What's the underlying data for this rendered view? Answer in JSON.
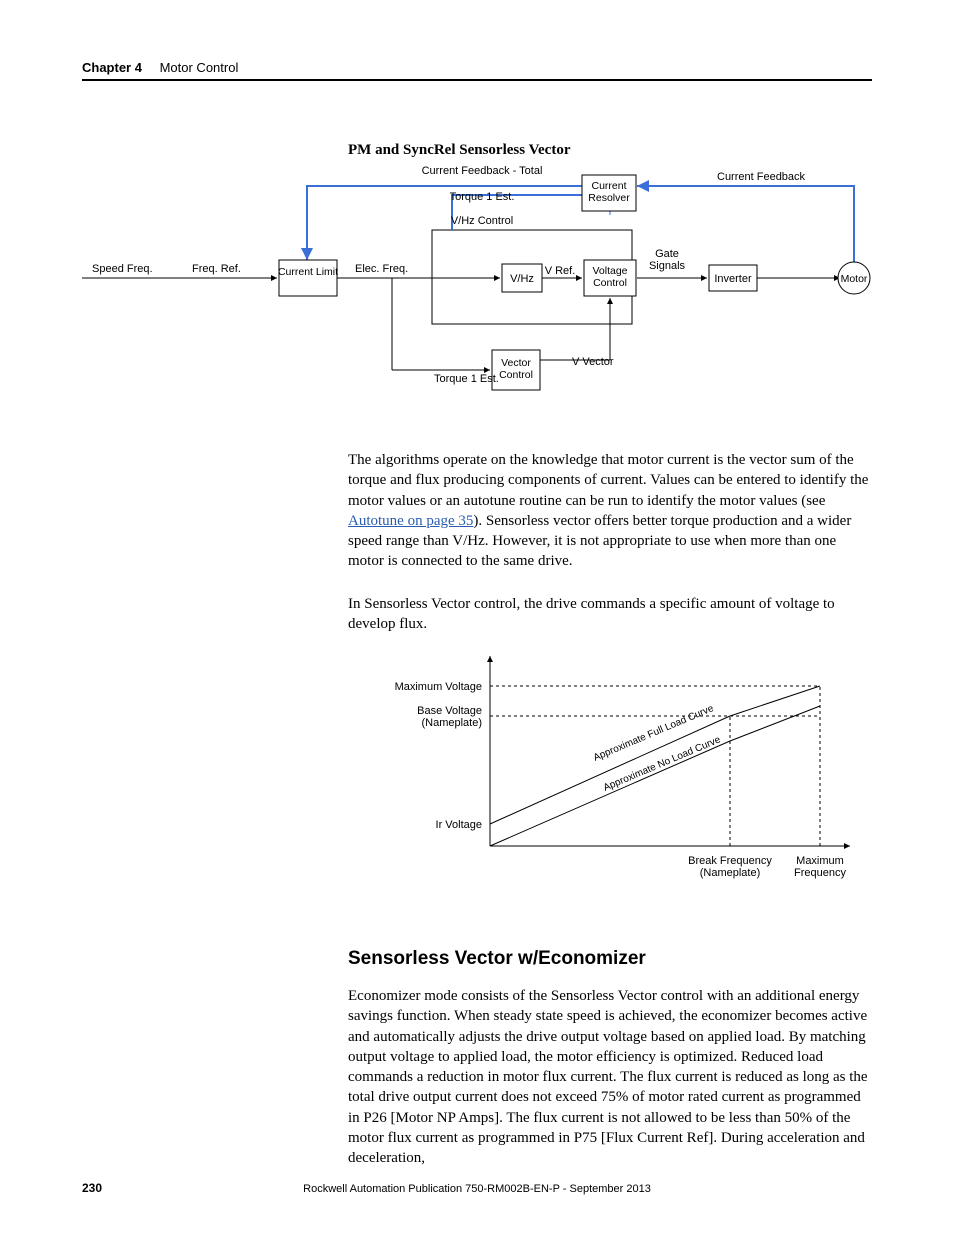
{
  "header": {
    "chapter": "Chapter 4",
    "section": "Motor Control"
  },
  "diagram": {
    "title": "PM and SyncRel Sensorless Vector",
    "labels": {
      "speed_freq": "Speed Freq.",
      "freq_ref": "Freq. Ref.",
      "current_limit": "Current\nLimit",
      "elec_freq": "Elec. Freq.",
      "current_feedback_total": "Current Feedback - Total",
      "torque1est_top": "Torque 1 Est.",
      "vhz_control": "V/Hz Control",
      "vhz": "V/Hz",
      "vref": "V Ref.",
      "voltage_control": "Voltage\nControl",
      "gate_signals": "Gate\nSignals",
      "inverter": "Inverter",
      "motor": "Motor",
      "current_feedback": "Current Feedback",
      "current_resolver": "Current\nResolver",
      "torque1est_bottom": "Torque 1 Est.",
      "vector_control": "Vector\nControl",
      "v_vector": "V Vector"
    }
  },
  "paragraphs": {
    "p1_a": "The algorithms operate on the knowledge that motor current is the vector sum of the torque and flux producing components of current. Values can be entered to identify the motor values or an autotune routine can be run to identify the motor values (see ",
    "p1_link": "Autotune on page 35",
    "p1_b": "). Sensorless vector offers better torque production and a wider speed range than V/Hz. However, it is not appropriate to use when more than one motor is connected to the same drive.",
    "p2": "In Sensorless Vector control, the drive commands a specific amount of voltage to develop flux."
  },
  "chart_data": {
    "type": "line",
    "title": "",
    "y_axis_labels": [
      "Ir Voltage",
      "Base Voltage (Nameplate)",
      "Maximum Voltage"
    ],
    "x_axis_labels": [
      "Break Frequency (Nameplate)",
      "Maximum Frequency"
    ],
    "series": [
      {
        "name": "Approximate Full Load Curve",
        "x": [
          0,
          0.7,
          1.0
        ],
        "y": [
          0.15,
          0.82,
          1.0
        ]
      },
      {
        "name": "Approximate No Load Curve",
        "x": [
          0,
          0.7,
          1.0
        ],
        "y": [
          0.0,
          0.7,
          0.88
        ]
      }
    ],
    "guidelines": {
      "horiz_at_y": [
        0.82,
        1.0
      ],
      "vert_at_x": [
        0.7,
        1.0
      ]
    }
  },
  "subheading": "Sensorless Vector w/Economizer",
  "paragraphs2": {
    "p3": "Economizer mode consists of the Sensorless Vector control with an additional energy savings function. When steady state speed is achieved, the economizer becomes active and automatically adjusts the drive output voltage based on applied load. By matching output voltage to applied load, the motor efficiency is optimized. Reduced load commands a reduction in motor flux current. The flux current is reduced as long as the total drive output current does not exceed 75% of motor rated current as programmed in P26 [Motor NP Amps]. The flux current is not allowed to be less than 50% of the motor flux current as programmed in P75 [Flux Current Ref]. During acceleration and deceleration,"
  },
  "footer": {
    "page": "230",
    "publication": "Rockwell Automation Publication 750-RM002B-EN-P - September 2013"
  }
}
